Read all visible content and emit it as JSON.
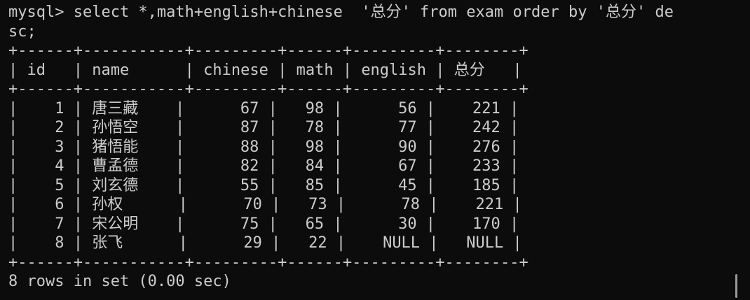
{
  "terminal": {
    "prompt": "mysql> ",
    "command_line_1": "select *,math+english+chinese  '总分' from exam order by '总分' de",
    "command_line_2": "sc;",
    "border": "+------+-----------+---------+------+---------+--------+",
    "header_row": "| id   | name      | chinese | math | english | 总分   |",
    "rows": [
      "|    1 | 唐三藏    |      67 |   98 |      56 |    221 |",
      "|    2 | 孙悟空    |      87 |   78 |      77 |    242 |",
      "|    3 | 猪悟能    |      88 |   98 |      90 |    276 |",
      "|    4 | 曹孟德    |      82 |   84 |      67 |    233 |",
      "|    5 | 刘玄德    |      55 |   85 |      45 |    185 |",
      "|    6 | 孙权      |      70 |   73 |      78 |    221 |",
      "|    7 | 宋公明    |      75 |   65 |      30 |    170 |",
      "|    8 | 张飞      |      29 |   22 |    NULL |   NULL |"
    ],
    "result_summary": "8 rows in set (0.00 sec)"
  },
  "colors": {
    "background": "#0c0c0c",
    "text": "#cccccc"
  }
}
